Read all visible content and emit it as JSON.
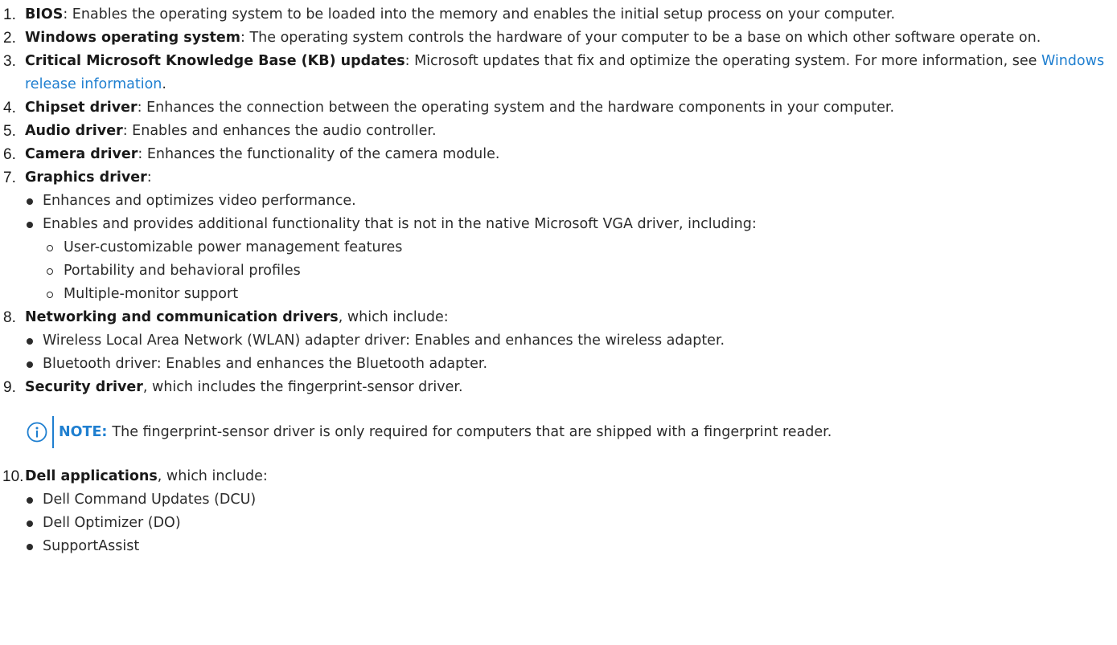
{
  "items": [
    {
      "num": "1.",
      "term": "BIOS",
      "text": ": Enables the operating system to be loaded into the memory and enables the initial setup process on your computer."
    },
    {
      "num": "2.",
      "term": "Windows operating system",
      "text": ": The operating system controls the hardware of your computer to be a base on which other software operate on."
    },
    {
      "num": "3.",
      "term": "Critical Microsoft Knowledge Base (KB) updates",
      "text": ": Microsoft updates that fix and optimize the operating system. For more information, see ",
      "link": "Windows release information",
      "text_after": "."
    },
    {
      "num": "4.",
      "term": "Chipset driver",
      "text": ": Enhances the connection between the operating system and the hardware components in your computer."
    },
    {
      "num": "5.",
      "term": "Audio driver",
      "text": ": Enables and enhances the audio controller."
    },
    {
      "num": "6.",
      "term": "Camera driver",
      "text": ": Enhances the functionality of the camera module."
    },
    {
      "num": "7.",
      "term": "Graphics driver",
      "text": ":",
      "bullets": [
        "Enhances and optimizes video performance.",
        "Enables and provides additional functionality that is not in the native Microsoft VGA driver, including:"
      ],
      "sub_bullets": [
        "User-customizable power management features",
        "Portability and behavioral profiles",
        "Multiple-monitor support"
      ]
    },
    {
      "num": "8.",
      "term": "Networking and communication drivers",
      "text": ", which include:",
      "bullets": [
        "Wireless Local Area Network (WLAN) adapter driver: Enables and enhances the wireless adapter.",
        "Bluetooth driver: Enables and enhances the Bluetooth adapter."
      ]
    },
    {
      "num": "9.",
      "term": "Security driver",
      "text": ", which includes the fingerprint-sensor driver."
    },
    {
      "num": "10.",
      "term": "Dell applications",
      "text": ", which include:",
      "bullets": [
        "Dell Command Updates (DCU)",
        "Dell Optimizer (DO)",
        "SupportAssist"
      ]
    }
  ],
  "note": {
    "label": "NOTE:",
    "text": "The fingerprint-sensor driver is only required for computers that are shipped with a fingerprint reader.",
    "icon": "info-circle-icon"
  },
  "colors": {
    "accent": "#1f7fd0",
    "text": "#2b2b2b"
  }
}
